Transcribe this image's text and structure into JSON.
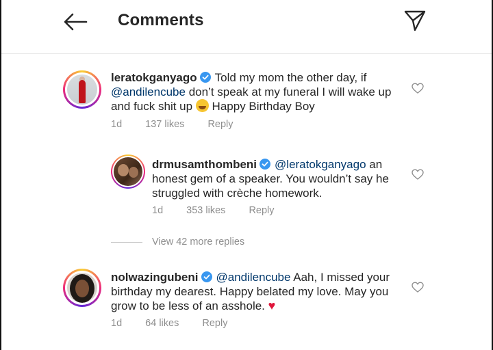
{
  "header": {
    "title": "Comments"
  },
  "comments": [
    {
      "username": "leratokganyago",
      "text_before": "Told my mom the other day, if",
      "mention": "@andilencube",
      "text_after": "don’t speak at my funeral I will wake up and fuck shit up",
      "text_end": "Happy Birthday Boy",
      "time": "1d",
      "likes": "137 likes",
      "reply": "Reply"
    },
    {
      "username": "drmusamthombeni",
      "mention": "@leratokganyago",
      "text": "an honest gem of a speaker. You wouldn’t say he struggled with crèche homework.",
      "time": "1d",
      "likes": "353 likes",
      "reply": "Reply"
    },
    {
      "username": "nolwazingubeni",
      "mention": "@andilencube",
      "text": "Aah, I missed your birthday my dearest. Happy belated my love. May you grow to be less of an asshole.",
      "time": "1d",
      "likes": "64 likes",
      "reply": "Reply"
    }
  ],
  "view_more": "View 42 more replies",
  "colors": {
    "mention": "#00376b",
    "meta": "#8e8e8e",
    "verified": "#3897f0",
    "heart_emoji": "#e0163b"
  },
  "icons": [
    "back-arrow-icon",
    "send-icon",
    "verified-badge-icon",
    "heart-icon",
    "grinning-sweat-emoji",
    "red-heart-emoji"
  ]
}
